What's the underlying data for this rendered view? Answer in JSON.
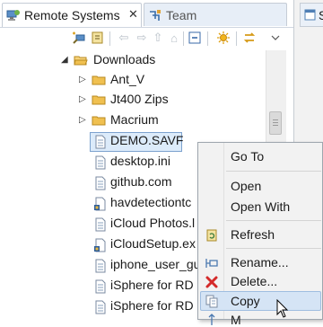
{
  "tabs": {
    "remote_systems": "Remote Systems",
    "team": "Team",
    "right_tab": "S"
  },
  "tree": [
    {
      "label": "Downloads",
      "icon": "open-folder-icon",
      "expanded": true
    },
    {
      "label": "Ant_V",
      "icon": "folder-icon"
    },
    {
      "label": "Jt400 Zips",
      "icon": "folder-icon"
    },
    {
      "label": "Macrium",
      "icon": "folder-icon"
    },
    {
      "label": "DEMO.SAVF",
      "icon": "file-icon",
      "selected": true
    },
    {
      "label": "desktop.ini",
      "icon": "file-icon"
    },
    {
      "label": "github.com",
      "icon": "file-icon"
    },
    {
      "label": "havdetectiontc",
      "icon": "executable-icon"
    },
    {
      "label": "iCloud Photos.l",
      "icon": "file-icon"
    },
    {
      "label": "iCloudSetup.ex",
      "icon": "executable-icon"
    },
    {
      "label": "iphone_user_gu",
      "icon": "file-icon"
    },
    {
      "label": "iSphere for RD",
      "icon": "file-icon"
    },
    {
      "label": "iSphere for RD",
      "icon": "file-icon"
    }
  ],
  "context_menu": {
    "go_to": "Go To",
    "open": "Open",
    "open_with": "Open With",
    "refresh": "Refresh",
    "rename": "Rename...",
    "delete": "Delete...",
    "copy": "Copy",
    "move": "M"
  },
  "colors": {
    "selection": "#dcebfa",
    "folder": "#e8b84a",
    "delete": "#d42a2a"
  }
}
